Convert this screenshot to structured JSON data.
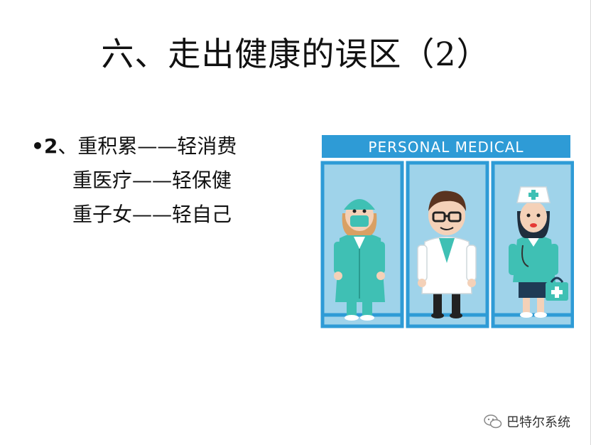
{
  "slide": {
    "title": "六、走出健康的误区（2）",
    "bullets": [
      {
        "marker": "•",
        "number": "2",
        "text": "、重积累——轻消费"
      },
      {
        "text": "重医疗——轻保健"
      },
      {
        "text": "重子女——轻自己"
      }
    ]
  },
  "figure": {
    "banner_text": "PERSONAL MEDICAL",
    "colors": {
      "banner": "#2e9bd6",
      "panel_bg": "#9fd3ea",
      "panel_border": "#2e9bd6",
      "teal": "#3fc0b4",
      "white_coat": "#ffffff"
    }
  },
  "watermark": {
    "icon": "wechat-icon",
    "text": "巴特尔系统"
  }
}
